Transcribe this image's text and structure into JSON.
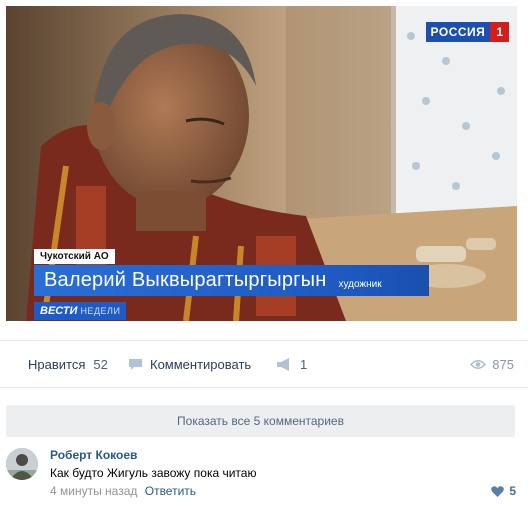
{
  "video": {
    "channel_name": "РОССИЯ",
    "channel_number": "1",
    "region": "Чукотский АО",
    "person_name": "Валерий Выквырагтыргыргын",
    "person_role": "художник",
    "show_name": "ВЕСТИ",
    "show_suffix": "НЕДЕЛИ"
  },
  "actions": {
    "like_label": "Нравится",
    "like_count": "52",
    "comment_label": "Комментировать",
    "share_count": "1",
    "views_count": "875"
  },
  "show_comments_label": "Показать все 5 комментариев",
  "comment": {
    "author": "Роберт Кокоев",
    "text": "Как будто Жигуль завожу пока читаю",
    "time": "4 минуты назад",
    "reply_label": "Ответить",
    "likes": "5"
  },
  "colors": {
    "link": "#2a5885",
    "accent_blue": "#1d59c0",
    "divider": "#e7e8ec"
  }
}
